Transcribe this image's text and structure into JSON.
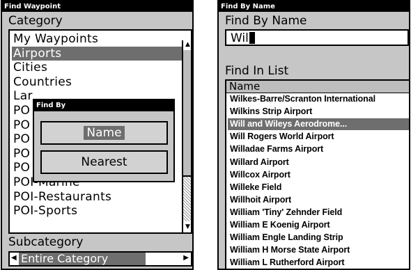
{
  "find_waypoint": {
    "title": "Find Waypoint",
    "category_heading": "Category",
    "categories": [
      {
        "label": "My Waypoints"
      },
      {
        "label": "Airports",
        "selected": true
      },
      {
        "label": "Cities"
      },
      {
        "label": "Countries"
      },
      {
        "label": "Lar"
      },
      {
        "label": "PO"
      },
      {
        "label": "PO"
      },
      {
        "label": "PO"
      },
      {
        "label": "PO"
      },
      {
        "label": "PO"
      },
      {
        "label": "POI-Marine"
      },
      {
        "label": "POI-Restaurants"
      },
      {
        "label": "POI-Sports"
      }
    ],
    "scroll_up_icon": "▲",
    "scroll_down_icon": "▼",
    "subcategory_heading": "Subcategory",
    "subcategory_value": "Entire Category",
    "sub_left_icon": "◀",
    "sub_right_icon": "▶"
  },
  "find_by_dialog": {
    "title": "Find By",
    "name_button": "Name",
    "nearest_button": "Nearest"
  },
  "find_by_name": {
    "title": "Find By Name",
    "heading": "Find By Name",
    "input_value": "Wil",
    "list_heading": "Find In List",
    "column_header": "Name",
    "results": [
      {
        "label": "Wilkes-Barre/Scranton International"
      },
      {
        "label": "Wilkins Strip Airport"
      },
      {
        "label": "Will and Wileys Aerodrome...",
        "selected": true
      },
      {
        "label": "Will Rogers World Airport"
      },
      {
        "label": "Willadae Farms Airport"
      },
      {
        "label": "Willard Airport"
      },
      {
        "label": "Willcox Airport"
      },
      {
        "label": "Willeke Field"
      },
      {
        "label": "Willhoit Airport"
      },
      {
        "label": "William 'Tiny' Zehnder Field"
      },
      {
        "label": "William E Koenig Airport"
      },
      {
        "label": "William Engle Landing Strip"
      },
      {
        "label": "William H Morse State Airport"
      },
      {
        "label": "William L Rutherford Airport"
      }
    ]
  }
}
